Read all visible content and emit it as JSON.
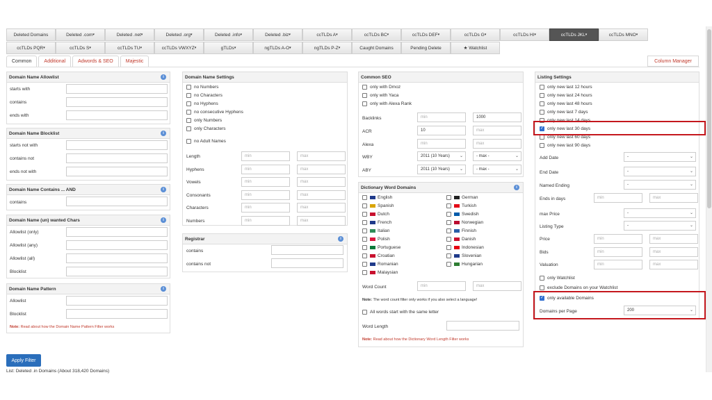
{
  "tabs_row1": [
    "Deleted Domains",
    "Deleted .com",
    "Deleted .net",
    "Deleted .org",
    "Deleted .info",
    "Deleted .biz",
    "ccTLDs A",
    "ccTLDs BC",
    "ccTLDs DEF",
    "ccTLDs G",
    "ccTLDs HI",
    "ccTLDs JKL",
    "ccTLDs MNO"
  ],
  "tabs_row2": [
    "ccTLDs PQR",
    "ccTLDs S",
    "ccTLDs TU",
    "ccTLDs VWXYZ",
    "gTLDs",
    "ngTLDs A-O",
    "ngTLDs P-Z",
    "Caught Domains",
    "Pending Delete",
    "★ Watchlist"
  ],
  "subtabs": [
    "Common",
    "Additional",
    "Adwords & SEO",
    "Majestic"
  ],
  "column_manager": "Column Manager",
  "allowlist": {
    "title": "Domain Name Allowlist",
    "rows": [
      "starts with",
      "contains",
      "ends with"
    ]
  },
  "blocklist": {
    "title": "Domain Name Blocklist",
    "rows": [
      "starts not with",
      "contains not",
      "ends not with"
    ]
  },
  "contains_and": {
    "title": "Domain Name Contains ... AND",
    "rows": [
      "contains"
    ]
  },
  "wanted_chars": {
    "title": "Domain Name (un) wanted Chars",
    "rows": [
      "Allowlist (only)",
      "Allowlist (any)",
      "Allowlist (all)",
      "Blocklist"
    ]
  },
  "pattern": {
    "title": "Domain Name Pattern",
    "rows": [
      "Allowlist",
      "Blocklist"
    ],
    "note_label": "Note:",
    "note_text": "Read about how the Domain Name Pattern Filter works"
  },
  "name_settings": {
    "title": "Domain Name Settings",
    "checks": [
      "no Numbers",
      "no Characters",
      "no Hyphens",
      "no consecutive Hyphens",
      "only Numbers",
      "only Characters"
    ],
    "adult": "no Adult Names",
    "ranges": [
      "Length",
      "Hyphens",
      "Vowels",
      "Consonants",
      "Characters",
      "Numbers"
    ],
    "min": "min",
    "max": "max"
  },
  "registrar": {
    "title": "Registrar",
    "rows": [
      "contains",
      "contains not"
    ]
  },
  "seo": {
    "title": "Common SEO",
    "checks": [
      "only with Dmoz",
      "only with Yaca",
      "only with Alexa Rank"
    ],
    "backlinks": "Backlinks",
    "backlinks_max": "1000",
    "acr": "ACR",
    "acr_min": "10",
    "alexa": "Alexa",
    "wby": "WBY",
    "wby_val": "2011 (10 Years)",
    "wby_max": "- max -",
    "aby": "ABY",
    "aby_val": "2011 (10 Years)",
    "aby_max": "- max -"
  },
  "dictionary": {
    "title": "Dictionary Word Domains",
    "left": [
      "English",
      "Spanish",
      "Dutch",
      "French",
      "Italian",
      "Polish",
      "Portuguese",
      "Croatian",
      "Romanian",
      "Malaysian"
    ],
    "right": [
      "German",
      "Turkish",
      "Swedish",
      "Norwegian",
      "Finnish",
      "Danish",
      "Indonesian",
      "Slovenian",
      "Hungarian"
    ],
    "word_count": "Word Count",
    "note1_label": "Note:",
    "note1": "The word count filter only works if you also select a language!",
    "same_letter": "All words start with the same letter",
    "word_length": "Word Length",
    "note2_label": "Note:",
    "note2": "Read about how the Dictionary Word Length Filter works"
  },
  "listing": {
    "title": "Listing Settings",
    "checks": [
      "only new last 12 hours",
      "only new last 24 hours",
      "only new last 48 hours",
      "only new last 7 days",
      "only new last 14 days",
      "only new last 30 days",
      "only new last 60 days",
      "only new last 90 days"
    ],
    "selects": [
      "Add Date",
      "End Date",
      "Named Ending"
    ],
    "ends_in_days": "Ends in days",
    "max_price": "max Price",
    "listing_type": "Listing Type",
    "ranges": [
      "Price",
      "Bids",
      "Valuation"
    ],
    "watch1": "only Watchlist",
    "watch2": "exclude Domains on your Watchlist",
    "available": "only available Domains",
    "per_page": "Domains per Page",
    "per_page_val": "200",
    "dash": "-"
  },
  "apply": "Apply Filter",
  "list_info": "List: Deleted .in Domains (About 318,420 Domains)",
  "colors": {
    "accent": "#2a6ebb",
    "red": "#c4161c",
    "link": "#c0392b"
  }
}
